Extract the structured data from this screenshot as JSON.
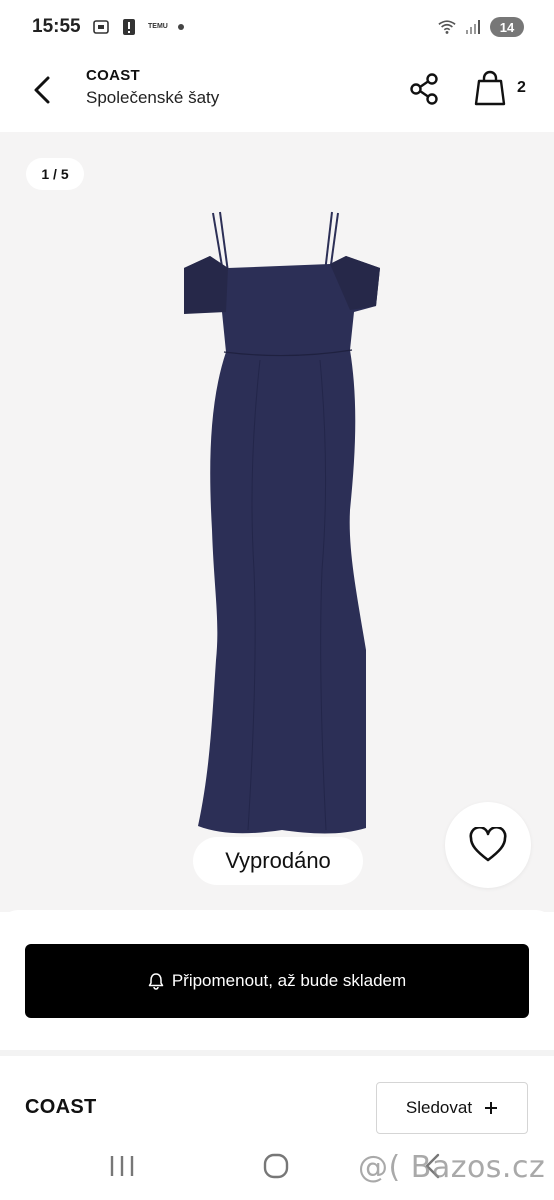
{
  "status_bar": {
    "time": "15:55",
    "temu_label": "TEMU",
    "battery_level": "14"
  },
  "header": {
    "brand": "COAST",
    "category": "Společenské šaty",
    "cart_count": "2"
  },
  "gallery": {
    "counter": "1 / 5",
    "sold_out_label": "Vyprodáno",
    "dress_color": "#2c2f56"
  },
  "actions": {
    "notify_label": "Připomenout, až bude skladem",
    "brand_name": "COAST",
    "follow_label": "Sledovat"
  },
  "watermark": "@( Bazos.cz",
  "colors": {
    "primary_button": "#000000",
    "gallery_bg": "#f5f4f4"
  }
}
